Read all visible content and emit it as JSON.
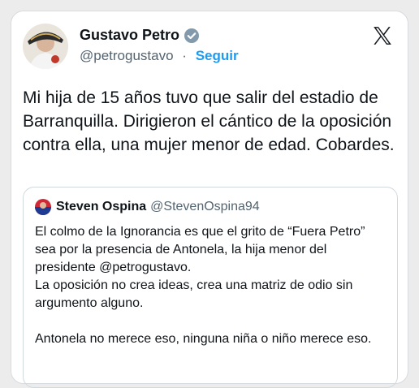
{
  "tweet": {
    "author_name": "Gustavo Petro",
    "author_handle": "@petrogustavo",
    "separator": "·",
    "follow_label": "Seguir",
    "text": "Mi hija de 15 años tuvo que salir del estadio de Barranquilla. Dirigieron el cántico de la oposición  contra ella, una mujer menor de edad. Cobardes."
  },
  "quoted": {
    "author_name": "Steven Ospina",
    "author_handle": "@StevenOspina94",
    "text": "El colmo de la Ignorancia es que el grito de “Fuera Petro” sea por la presencia de Antonela, la hija menor del presidente @petrogustavo.\nLa oposición no crea ideas, crea una matriz de odio sin argumento alguno.\n\nAntonela no merece eso, ninguna niña o niño merece eso."
  },
  "icons": {
    "verified": "verified-badge-icon",
    "platform": "x-logo-icon"
  },
  "colors": {
    "link": "#1d9bf0",
    "verified": "#829aab",
    "secondary_text": "#536471"
  }
}
